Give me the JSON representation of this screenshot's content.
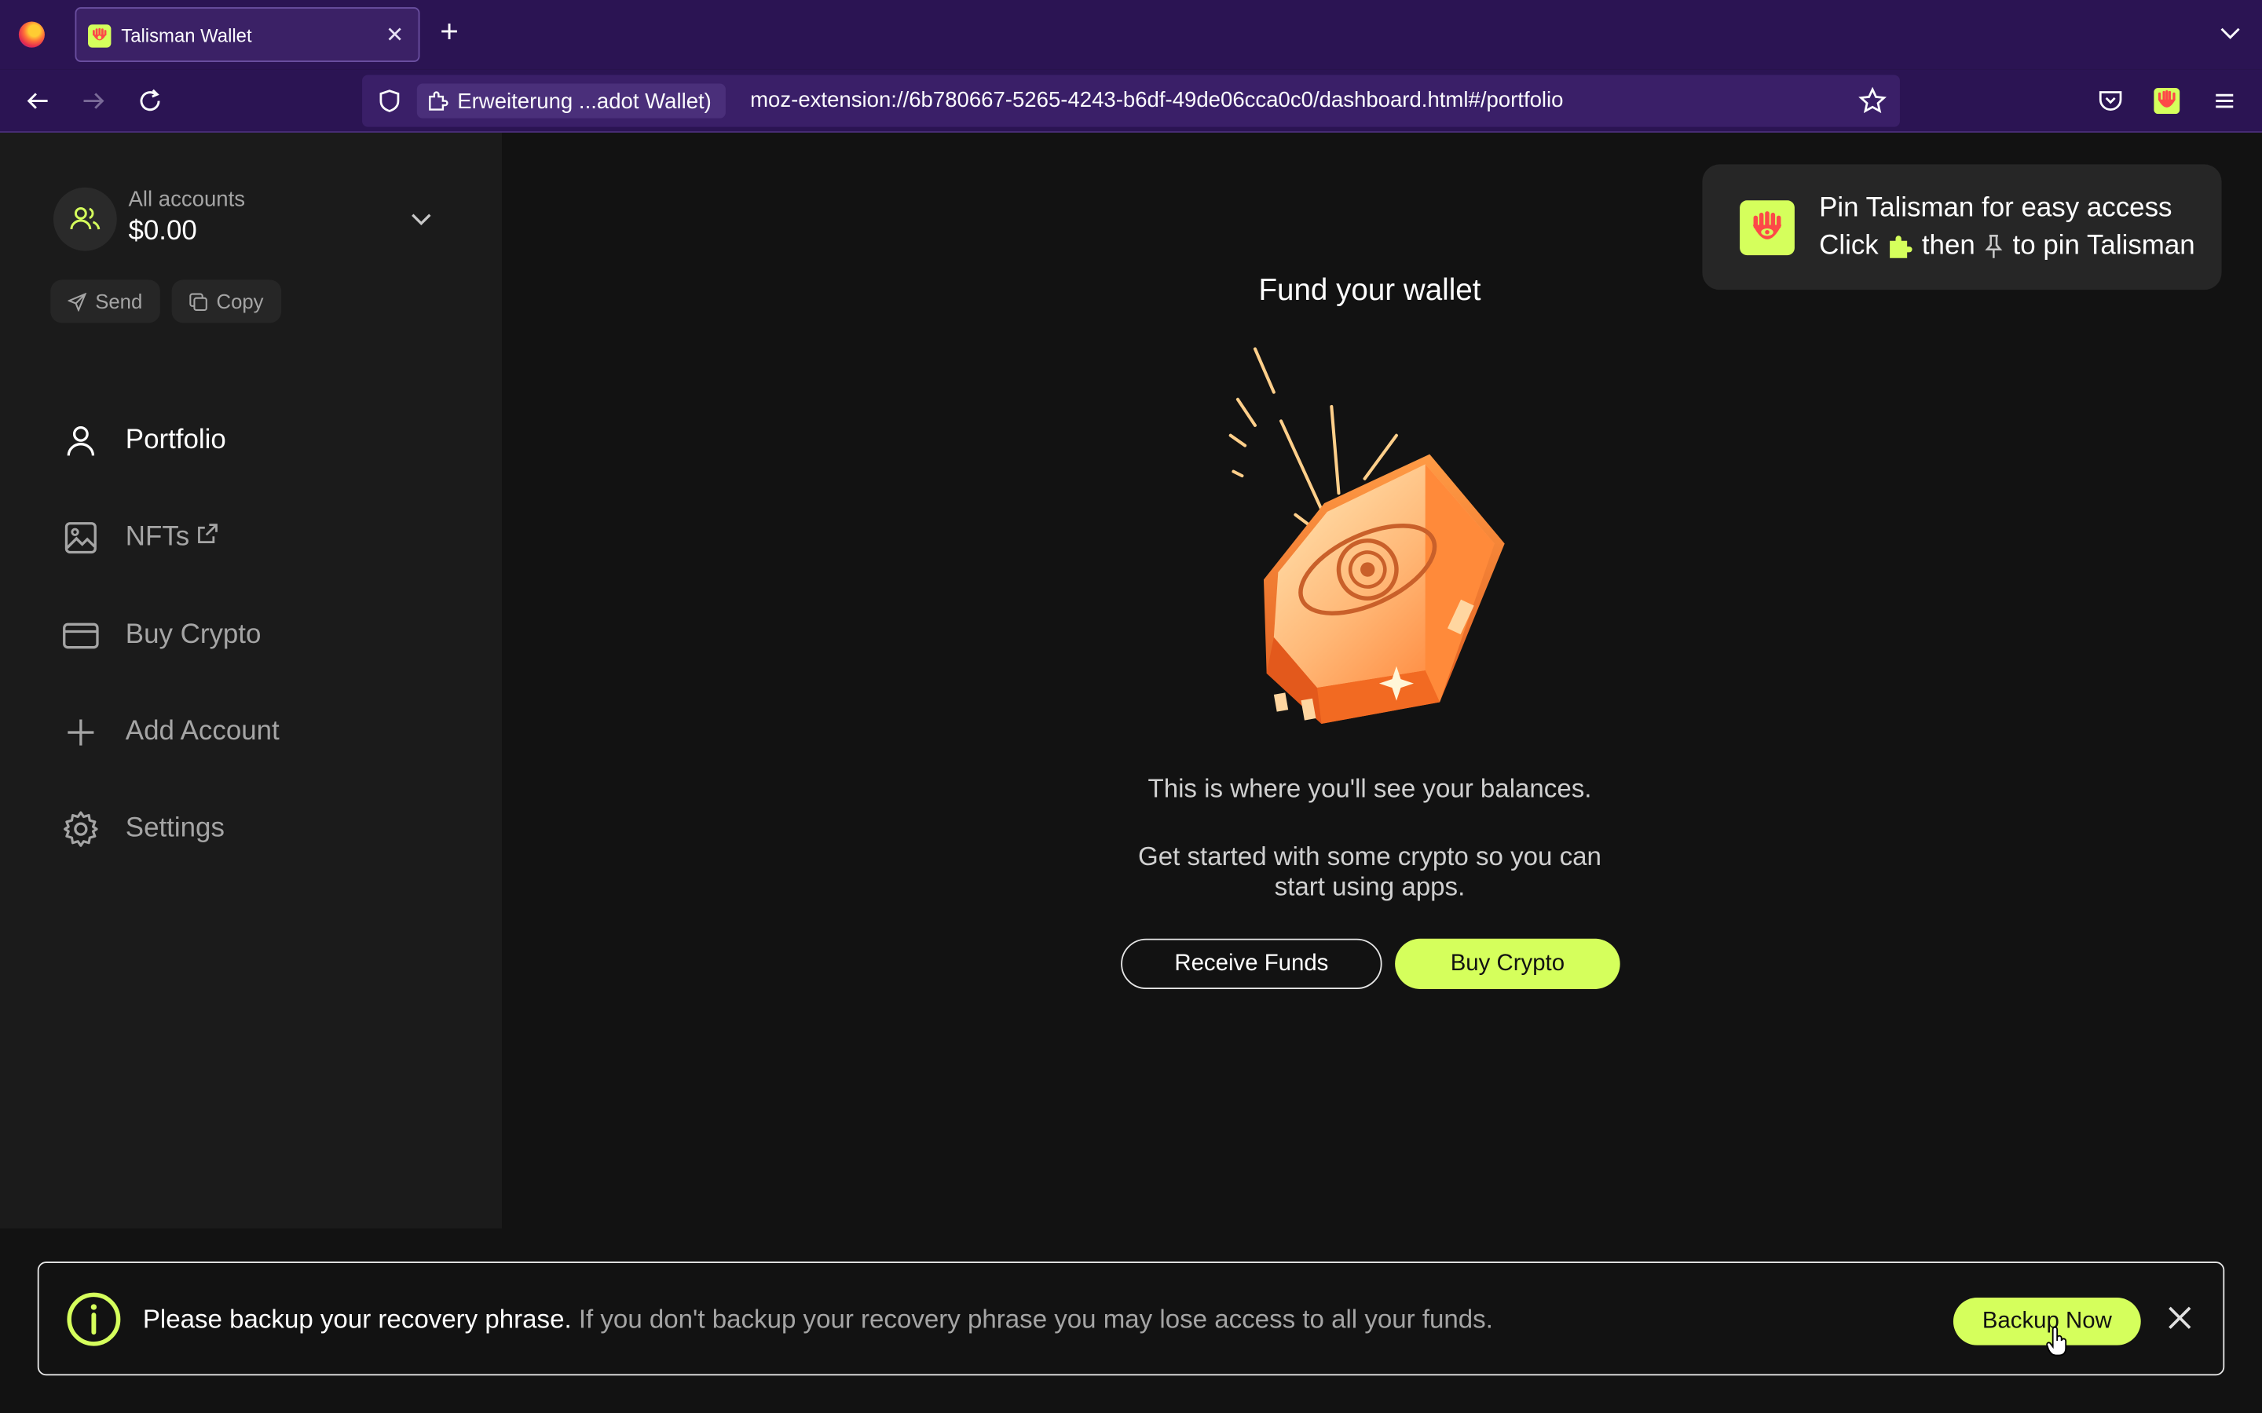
{
  "browser": {
    "tab_title": "Talisman Wallet",
    "identity_label": "Erweiterung ...adot Wallet)",
    "url": "moz-extension://6b780667-5265-4243-b6df-49de06cca0c0/dashboard.html#/portfolio"
  },
  "account": {
    "name": "All accounts",
    "balance": "$0.00",
    "send_label": "Send",
    "copy_label": "Copy"
  },
  "sidebar": {
    "items": [
      {
        "label": "Portfolio",
        "icon": "user-icon"
      },
      {
        "label": "NFTs",
        "icon": "image-icon"
      },
      {
        "label": "Buy Crypto",
        "icon": "credit-card-icon"
      },
      {
        "label": "Add Account",
        "icon": "plus-icon"
      },
      {
        "label": "Settings",
        "icon": "gear-icon"
      }
    ]
  },
  "pin": {
    "line1": "Pin Talisman for easy access",
    "click": "Click",
    "then": "then",
    "to_pin": "to pin Talisman"
  },
  "main": {
    "title": "Fund your wallet",
    "message1": "This is where you'll see your balances.",
    "message2": "Get started with some crypto so you can start using apps.",
    "receive_label": "Receive Funds",
    "buy_label": "Buy Crypto"
  },
  "banner": {
    "strong": "Please backup your recovery phrase.",
    "text": " If you don't backup your recovery phrase you may lose access to all your funds.",
    "button_label": "Backup Now"
  },
  "colors": {
    "accent": "#d5ff5c",
    "chrome": "#2b1453",
    "sidebar": "#1b1b1b",
    "background": "#121212"
  }
}
